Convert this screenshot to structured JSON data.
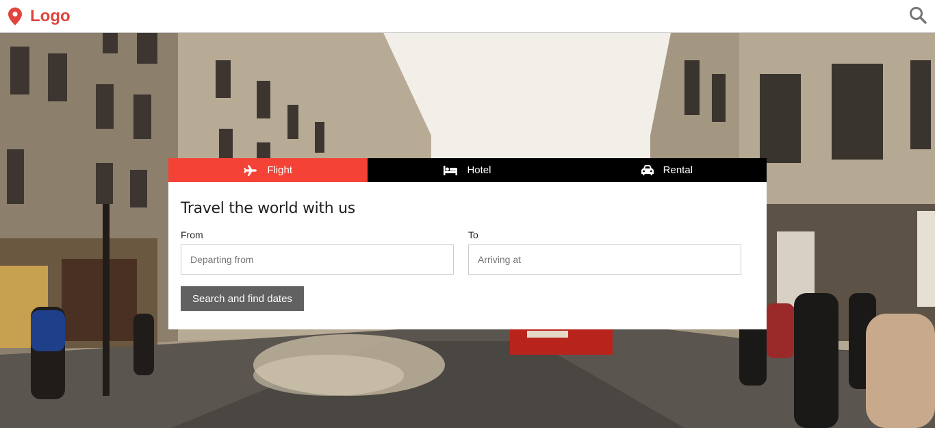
{
  "header": {
    "logo_label": "Logo",
    "logo_icon": "map-marker-icon",
    "search_icon": "search-icon"
  },
  "tabs": [
    {
      "label": "Flight",
      "icon": "plane-icon",
      "active": true
    },
    {
      "label": "Hotel",
      "icon": "bed-icon",
      "active": false
    },
    {
      "label": "Rental",
      "icon": "car-icon",
      "active": false
    }
  ],
  "form": {
    "title": "Travel the world with us",
    "from_label": "From",
    "from_placeholder": "Departing from",
    "to_label": "To",
    "to_placeholder": "Arriving at",
    "submit_label": "Search and find dates"
  },
  "colors": {
    "accent": "#f44336",
    "logo": "#e0443c",
    "tabbar": "#000000",
    "button": "#616161"
  }
}
